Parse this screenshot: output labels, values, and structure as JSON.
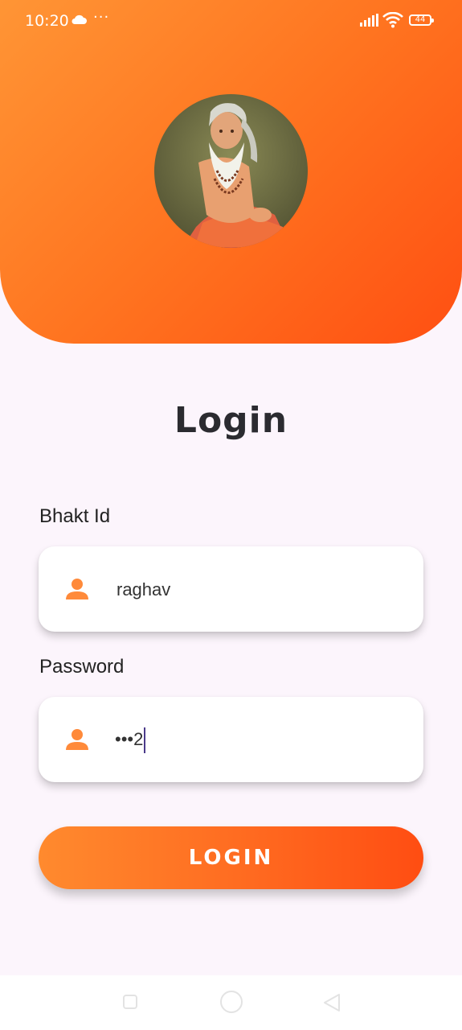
{
  "status_bar": {
    "time": "10:20",
    "icons": [
      "cloud-icon",
      "more-dots-icon",
      "signal-icon",
      "wifi-icon",
      "battery-icon"
    ],
    "more_dots": "···",
    "battery_level": "44"
  },
  "header": {
    "avatar": "guru-avatar",
    "colors": {
      "gradient_start": "#ff9535",
      "gradient_end": "#ff4f12"
    }
  },
  "login": {
    "title": "Login",
    "bhakt_id": {
      "label": "Bhakt Id",
      "value": "raghav",
      "icon": "person-icon"
    },
    "password": {
      "label": "Password",
      "value": "•••2",
      "icon": "person-icon"
    },
    "button_label": "LOGIN"
  },
  "nav_bar": {
    "icons": [
      "recents-square-icon",
      "home-circle-icon",
      "back-triangle-icon"
    ]
  },
  "colors": {
    "accent": "#ff6a20",
    "background": "#fcf5fc",
    "title_text": "#2b2b30",
    "icon_orange": "#ff8a3a"
  }
}
